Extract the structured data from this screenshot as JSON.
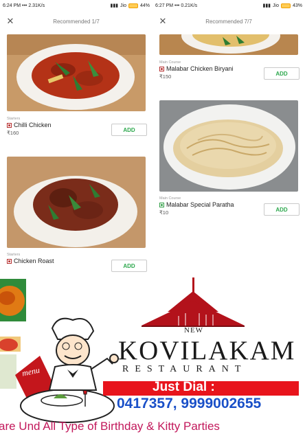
{
  "left_screen": {
    "status": {
      "time": "6:24 PM",
      "speed": "••• 2.31K/s",
      "carrier": "Jio",
      "battery": "44%"
    },
    "title": "Recommended 1/7",
    "items": [
      {
        "category": "Starters",
        "name": "Chilli Chicken",
        "price": "₹160",
        "add_label": "ADD"
      },
      {
        "category": "Starters",
        "name": "Chicken Roast",
        "add_label": "ADD"
      }
    ]
  },
  "right_screen": {
    "status": {
      "time": "6:27 PM",
      "speed": "••• 0.21K/s",
      "carrier": "Jio",
      "battery": "43%"
    },
    "title": "Recommended 7/7",
    "items": [
      {
        "category": "Main Course",
        "name": "Malabar Chicken Biryani",
        "price": "₹150",
        "add_label": "ADD"
      },
      {
        "category": "Main Course",
        "name": "Malabar Special Paratha",
        "price": "₹10",
        "add_label": "ADD"
      }
    ]
  },
  "banner": {
    "brand_prefix": "NEW",
    "brand_name": "KOVILAKAM",
    "brand_sub": "RESTAURANT",
    "justdial_label": "Just Dial :",
    "phone": "0417357, 9999002655",
    "tagline": "are Und        All Type of Birthday & Kitty Parties",
    "menu_text": "menu"
  },
  "colors": {
    "add_green": "#2ea84e",
    "nonveg_red": "#b52b2b",
    "veg_green": "#2f9e44",
    "jd_red": "#e8141c",
    "phone_blue": "#1a50c8",
    "roof_red": "#b3121b",
    "tagline_pink": "#c2185b"
  }
}
